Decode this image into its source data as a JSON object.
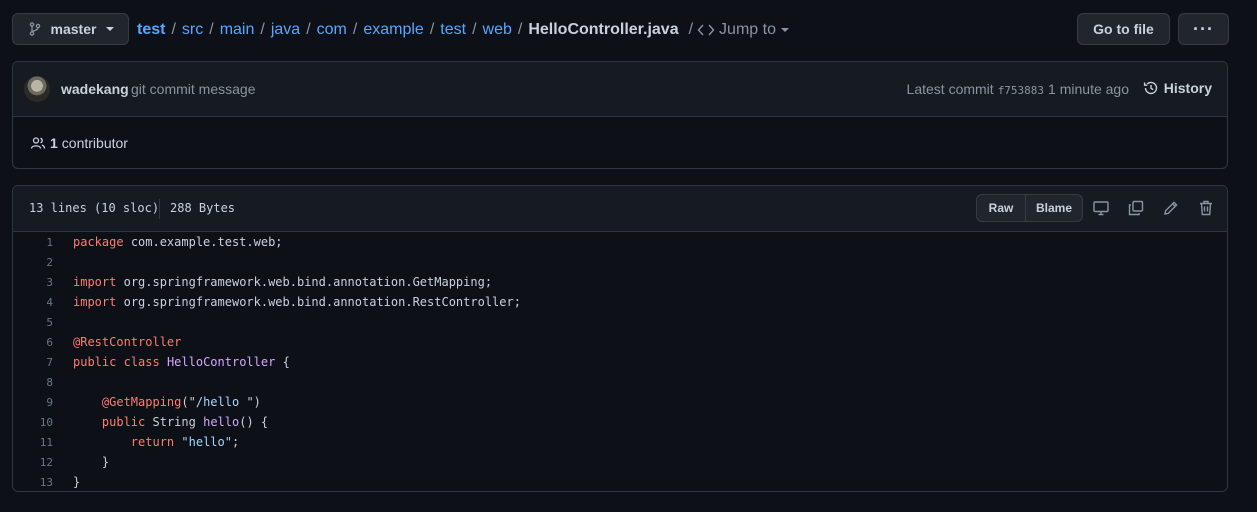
{
  "branch": {
    "label": "master",
    "icon": "git-branch-icon"
  },
  "breadcrumb": {
    "repo": "test",
    "dirs": [
      "src",
      "main",
      "java",
      "com",
      "example",
      "test",
      "web"
    ],
    "file": "HelloController.java",
    "jump_label": "Jump to"
  },
  "actions": {
    "go_to_file": "Go to file",
    "more": "···"
  },
  "commit": {
    "author": "wadekang",
    "message": "git commit message",
    "latest_label": "Latest commit",
    "sha": "f753883",
    "time": "1 minute ago",
    "history_label": "History",
    "contributors_count": "1",
    "contributors_label": "contributor"
  },
  "file": {
    "lines_info": "13 lines (10 sloc)",
    "size": "288 Bytes",
    "raw_label": "Raw",
    "blame_label": "Blame"
  },
  "code": [
    {
      "n": "1",
      "tokens": [
        [
          "kw",
          "package"
        ],
        [
          "",
          "com.example.test.web;"
        ]
      ]
    },
    {
      "n": "2",
      "tokens": []
    },
    {
      "n": "3",
      "tokens": [
        [
          "kw",
          "import"
        ],
        [
          "",
          "org.springframework.web.bind.annotation.GetMapping;"
        ]
      ]
    },
    {
      "n": "4",
      "tokens": [
        [
          "kw",
          "import"
        ],
        [
          "",
          "org.springframework.web.bind.annotation.RestController;"
        ]
      ]
    },
    {
      "n": "5",
      "tokens": []
    },
    {
      "n": "6",
      "tokens": [
        [
          "kw",
          "@RestController"
        ]
      ]
    },
    {
      "n": "7",
      "tokens": [
        [
          "kw",
          "public"
        ],
        [
          "kw",
          "class"
        ],
        [
          "cls",
          "HelloController"
        ],
        [
          "",
          "{"
        ]
      ]
    },
    {
      "n": "8",
      "tokens": []
    },
    {
      "n": "9",
      "tokens": [
        [
          "",
          "    "
        ],
        [
          "kw",
          "@GetMapping"
        ],
        [
          "",
          "(\""
        ],
        [
          "str",
          "/hello"
        ],
        [
          "",
          "\")"
        ]
      ]
    },
    {
      "n": "10",
      "tokens": [
        [
          "",
          "    "
        ],
        [
          "kw",
          "public"
        ],
        [
          "",
          "String"
        ],
        [
          "fn",
          "hello"
        ],
        [
          "",
          "() {"
        ]
      ]
    },
    {
      "n": "11",
      "tokens": [
        [
          "",
          "        "
        ],
        [
          "kw",
          "return"
        ],
        [
          "str",
          "\"hello\""
        ],
        [
          "",
          ";"
        ]
      ]
    },
    {
      "n": "12",
      "tokens": [
        [
          "",
          "    }"
        ]
      ]
    },
    {
      "n": "13",
      "tokens": [
        [
          "",
          "}"
        ]
      ]
    }
  ],
  "colors": {
    "background": "#0d1117",
    "link": "#58a6ff",
    "keyword": "#ff7b72",
    "class_name": "#d2a8ff",
    "string": "#a5d6ff"
  }
}
